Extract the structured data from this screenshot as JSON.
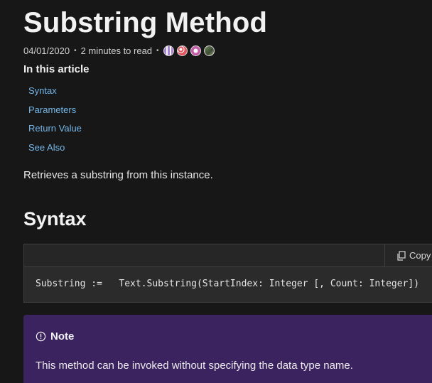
{
  "article": {
    "title": "Substring Method",
    "date": "04/01/2020",
    "read_time": "2 minutes to read",
    "separator": "•"
  },
  "contributors": [
    "avatar-1",
    "avatar-2",
    "avatar-3",
    "avatar-4"
  ],
  "toc": {
    "heading": "In this article",
    "items": [
      {
        "label": "Syntax"
      },
      {
        "label": "Parameters"
      },
      {
        "label": "Return Value"
      },
      {
        "label": "See Also"
      }
    ]
  },
  "summary": "Retrieves a substring from this instance.",
  "syntax": {
    "heading": "Syntax",
    "copy_label": "Copy",
    "code": "Substring :=   Text.Substring(StartIndex: Integer [, Count: Integer])"
  },
  "note": {
    "title": "Note",
    "text": "This method can be invoked without specifying the data type name."
  },
  "colors": {
    "background": "#171717",
    "link": "#75b6e7",
    "note_background": "#3b2360",
    "code_background": "#2b2b2b"
  },
  "icons": {
    "copy": "copy-icon",
    "note": "info-circle-icon"
  }
}
